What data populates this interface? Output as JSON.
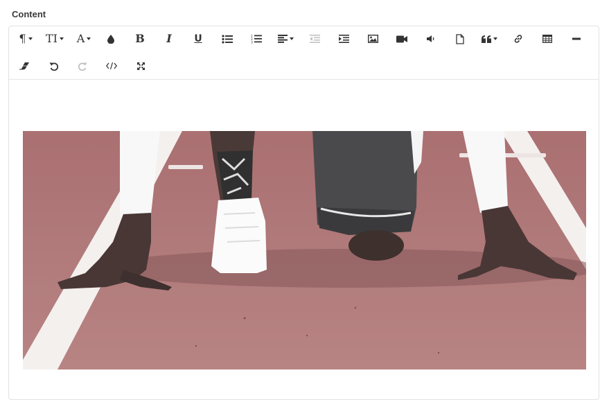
{
  "field": {
    "label": "Content"
  },
  "toolbar": {
    "row1": [
      {
        "name": "paragraph-style-button",
        "icon": "pilcrow-icon",
        "glyph": "¶",
        "caret": true
      },
      {
        "name": "font-size-button",
        "icon": "text-height-icon",
        "glyph": "TI",
        "caret": true
      },
      {
        "name": "font-family-button",
        "icon": "font-icon",
        "glyph": "A",
        "caret": true
      },
      {
        "name": "text-color-button",
        "icon": "droplet-icon"
      },
      {
        "name": "bold-button",
        "icon": "bold-icon",
        "glyph": "B"
      },
      {
        "name": "italic-button",
        "icon": "italic-icon",
        "glyph": "I"
      },
      {
        "name": "underline-button",
        "icon": "underline-icon",
        "glyph": "U"
      },
      {
        "name": "unordered-list-button",
        "icon": "list-ul-icon"
      },
      {
        "name": "ordered-list-button",
        "icon": "list-ol-icon"
      },
      {
        "name": "align-button",
        "icon": "align-left-icon",
        "caret": true
      },
      {
        "name": "outdent-button",
        "icon": "outdent-icon",
        "disabled": true
      },
      {
        "name": "indent-button",
        "icon": "indent-icon"
      },
      {
        "name": "insert-image-button",
        "icon": "image-icon"
      },
      {
        "name": "insert-video-button",
        "icon": "video-camera-icon"
      },
      {
        "name": "insert-audio-button",
        "icon": "volume-icon"
      },
      {
        "name": "insert-file-button",
        "icon": "file-icon"
      },
      {
        "name": "quote-button",
        "icon": "quote-icon",
        "caret": true
      },
      {
        "name": "insert-link-button",
        "icon": "link-icon"
      },
      {
        "name": "insert-table-button",
        "icon": "table-icon"
      },
      {
        "name": "horizontal-rule-button",
        "icon": "minus-icon"
      }
    ],
    "row2": [
      {
        "name": "clear-formatting-button",
        "icon": "eraser-icon"
      },
      {
        "name": "undo-button",
        "icon": "undo-icon"
      },
      {
        "name": "redo-button",
        "icon": "redo-icon",
        "disabled": true
      },
      {
        "name": "code-view-button",
        "icon": "code-icon"
      },
      {
        "name": "fullscreen-button",
        "icon": "expand-icon"
      }
    ]
  },
  "content": {
    "image": {
      "subject": "runner-in-starting-position",
      "track_color": "#a86a6c",
      "line_color": "#f4f1ef"
    }
  }
}
